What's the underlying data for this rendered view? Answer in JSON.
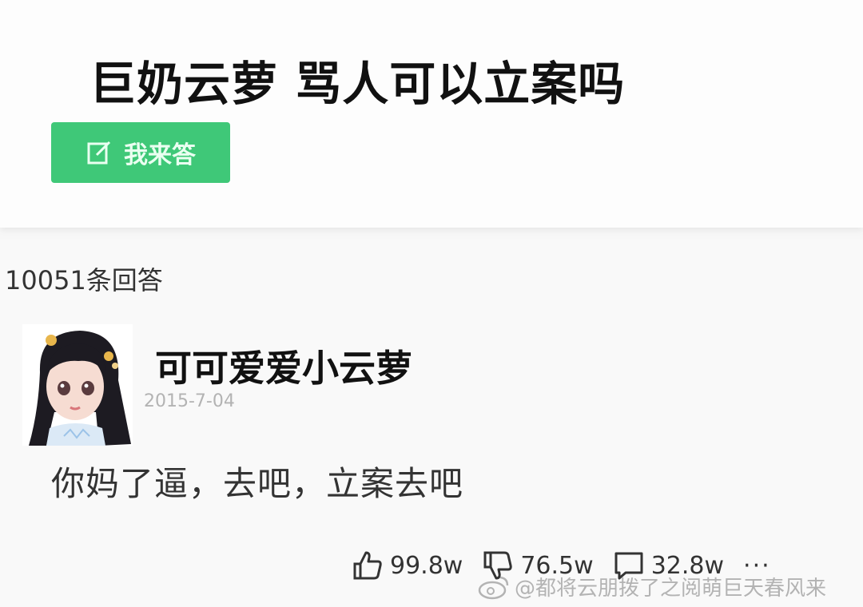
{
  "question": {
    "title": "巨奶云萝 骂人可以立案吗",
    "answer_button_label": "我来答",
    "accent_color": "#3fc878"
  },
  "answers": {
    "count_label": "10051条回答"
  },
  "answer": {
    "username": "可可爱爱小云萝",
    "date": "2015-7-04",
    "text": "你妈了逼，去吧，立案去吧",
    "likes": "99.8w",
    "dislikes": "76.5w",
    "comments": "32.8w",
    "more_label": "···"
  },
  "icons": {
    "answer_button": "edit-icon",
    "like": "thumbs-up-icon",
    "dislike": "thumbs-down-icon",
    "comment": "comment-icon",
    "watermark": "weibo-icon"
  },
  "watermark": {
    "text": "@都将云朋拨了之阅萌巨天春风来"
  }
}
